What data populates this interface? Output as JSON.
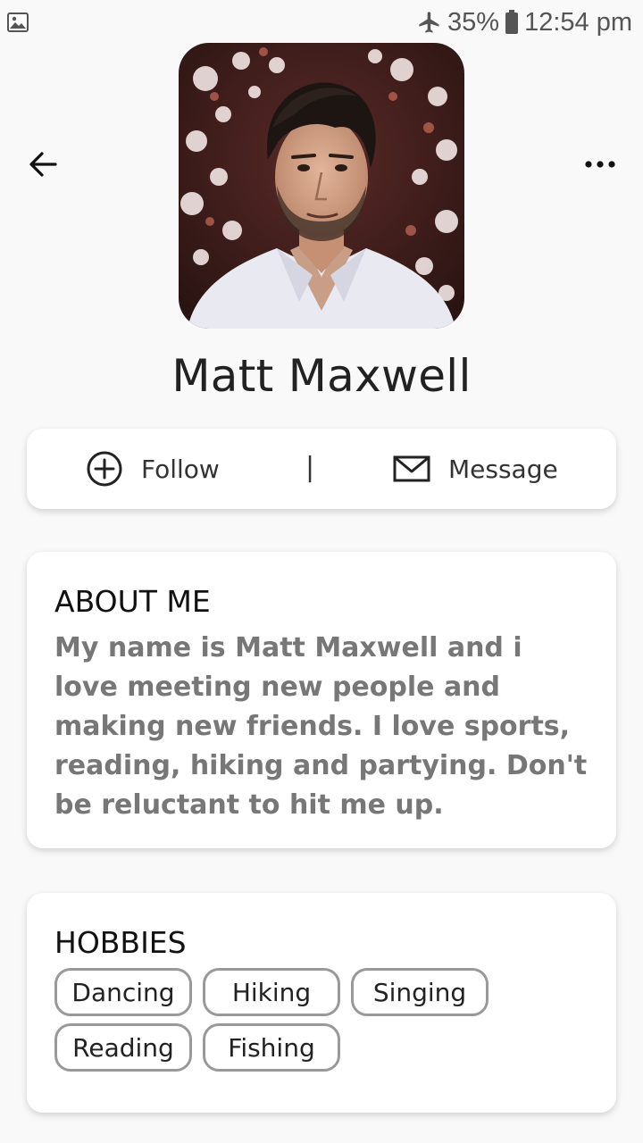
{
  "status_bar": {
    "battery": "35%",
    "time": "12:54 pm",
    "icons": [
      "gallery-icon",
      "airplane-icon",
      "battery-icon"
    ]
  },
  "header": {
    "back_icon": "arrow-left-icon",
    "more_icon": "more-horizontal-icon"
  },
  "profile": {
    "name": "Matt Maxwell"
  },
  "actions": {
    "follow_label": "Follow",
    "follow_icon": "plus-circle-icon",
    "divider": "|",
    "message_label": "Message",
    "message_icon": "envelope-icon"
  },
  "about": {
    "title": "ABOUT ME",
    "text": "My name is Matt Maxwell and i love meeting new people and making new friends. I love sports, reading, hiking and partying. Don't be reluctant to hit me up."
  },
  "hobbies": {
    "title": "HOBBIES",
    "items": [
      "Dancing",
      "Hiking",
      "Singing",
      "Reading",
      "Fishing"
    ]
  }
}
